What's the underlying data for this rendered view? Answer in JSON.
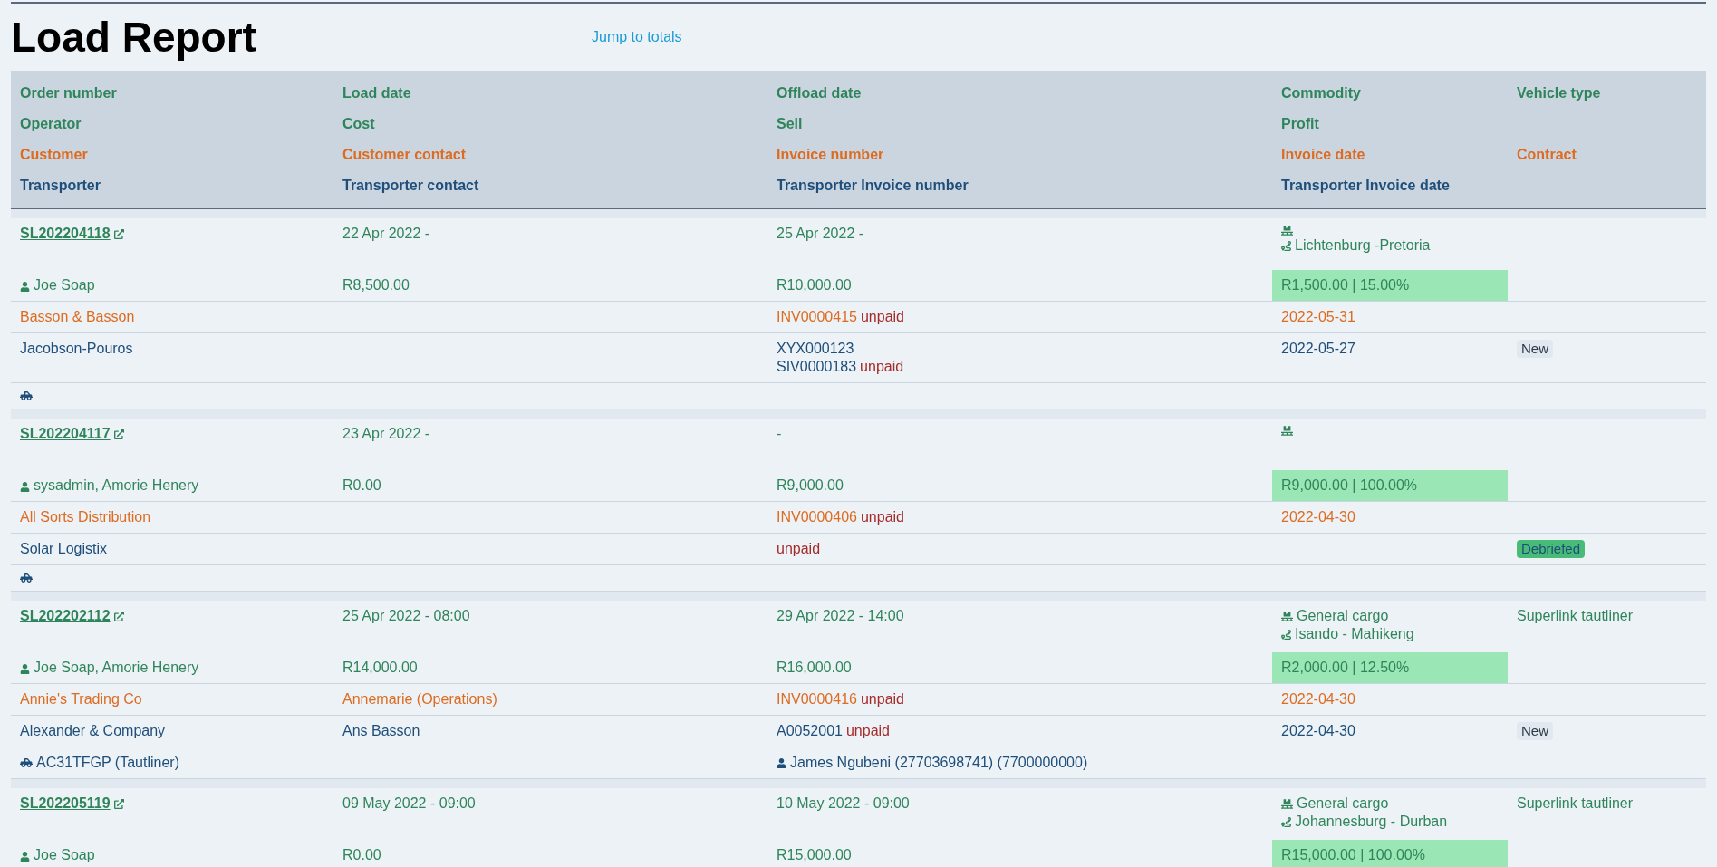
{
  "title": "Load Report",
  "jump_link": "Jump to totals",
  "header_rows": [
    {
      "kind": "load",
      "cells": [
        "Order number",
        "Load date",
        "Offload date",
        "Commodity",
        "Vehicle type"
      ]
    },
    {
      "kind": "finance",
      "cells": [
        "Operator",
        "Cost",
        "Sell",
        "Profit",
        null
      ]
    },
    {
      "kind": "customer",
      "cells": [
        "Customer",
        "Customer contact",
        "Invoice number",
        "Invoice date",
        "Contract"
      ]
    },
    {
      "kind": "transporter",
      "cells": [
        "Transporter",
        "Transporter contact",
        "Transporter Invoice number",
        "Transporter Invoice date",
        null
      ]
    }
  ],
  "loads": [
    {
      "order_number": "SL202204118",
      "load_date": "22 Apr 2022 -",
      "offload_date": "25 Apr 2022 -",
      "route": "Lichtenburg -Pretoria",
      "operator": "Joe Soap",
      "cost": "R8,500.00",
      "sell": "R10,000.00",
      "profit": "R1,500.00 | 15.00%",
      "customer": "Basson & Basson",
      "invoice": {
        "number": "INV0000415",
        "status": "unpaid"
      },
      "invoice_date": "2022-05-31",
      "transporter": "Jacobson-Pouros",
      "transporter_invoices": [
        {
          "number": "XYX000123"
        },
        {
          "number": "SIV0000183",
          "status": "unpaid"
        }
      ],
      "transporter_invoice_date": "2022-05-27",
      "badge": {
        "label": "New",
        "kind": "new"
      }
    },
    {
      "order_number": "SL202204117",
      "load_date": "23 Apr 2022 -",
      "offload_date": "-",
      "operator": "sysadmin, Amorie Henery",
      "cost": "R0.00",
      "sell": "R9,000.00",
      "profit": "R9,000.00 | 100.00%",
      "customer": "All Sorts Distribution",
      "invoice": {
        "number": "INV0000406",
        "status": "unpaid"
      },
      "invoice_date": "2022-04-30",
      "transporter": "Solar Logistix",
      "transporter_invoices": [
        {
          "status": "unpaid"
        }
      ],
      "badge": {
        "label": "Debriefed",
        "kind": "debriefed"
      }
    },
    {
      "order_number": "SL202202112",
      "load_date": "25 Apr 2022 - 08:00",
      "offload_date": "29 Apr 2022 - 14:00",
      "commodity": "General cargo",
      "route": "Isando - Mahikeng",
      "vehicle_type": "Superlink tautliner",
      "operator": "Joe Soap, Amorie Henery",
      "cost": "R14,000.00",
      "sell": "R16,000.00",
      "profit": "R2,000.00 | 12.50%",
      "customer": "Annie's Trading Co",
      "customer_contact": "Annemarie (Operations)",
      "invoice": {
        "number": "INV0000416",
        "status": "unpaid"
      },
      "invoice_date": "2022-04-30",
      "transporter": "Alexander & Company",
      "transporter_contact": "Ans Basson",
      "transporter_invoices": [
        {
          "number": "A0052001",
          "status": "unpaid"
        }
      ],
      "transporter_invoice_date": "2022-04-30",
      "badge": {
        "label": "New",
        "kind": "new"
      },
      "vehicle": "AC31TFGP (Tautliner)",
      "driver": "James Ngubeni (27703698741) (7700000000)"
    },
    {
      "order_number": "SL202205119",
      "load_date": "09 May 2022 - 09:00",
      "offload_date": "10 May 2022 - 09:00",
      "commodity": "General cargo",
      "route": "Johannesburg - Durban",
      "vehicle_type": "Superlink tautliner",
      "operator": "Joe Soap",
      "cost": "R0.00",
      "sell": "R15,000.00",
      "profit": "R15,000.00 | 100.00%"
    }
  ]
}
